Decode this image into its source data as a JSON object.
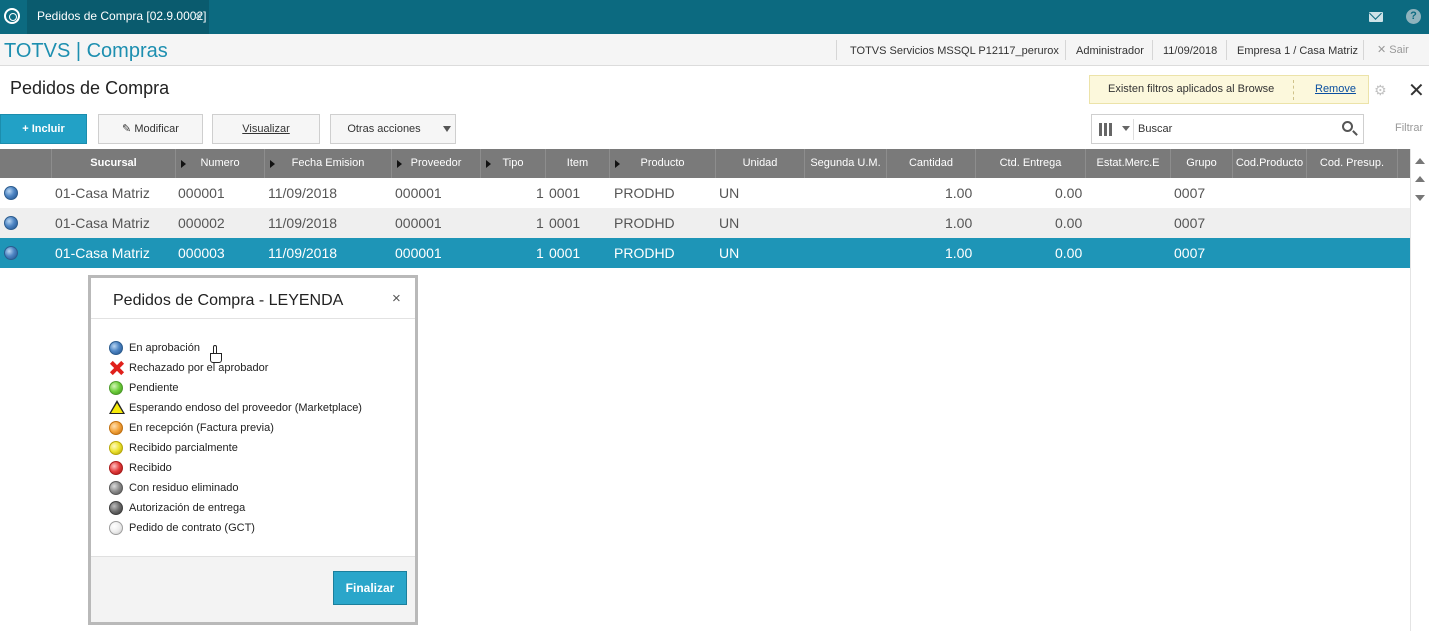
{
  "window": {
    "tab_title": "Pedidos de Compra [02.9.0002]",
    "tab_close": "×"
  },
  "header": {
    "brand": "TOTVS | Compras",
    "server": "TOTVS Servicios MSSQL P12117_perurox",
    "user": "Administrador",
    "date": "11/09/2018",
    "company": "Empresa 1 / Casa Matriz",
    "exit_label": "✕ Sair"
  },
  "page": {
    "title": "Pedidos de Compra",
    "close": "✕"
  },
  "notice": {
    "text": "Existen filtros aplicados al Browse",
    "remove_label": "Remove"
  },
  "toolbar": {
    "include_label": "+ Incluir",
    "modify_label": "✎ Modificar",
    "view_label": "Visualizar",
    "other_label": "Otras acciones"
  },
  "search": {
    "placeholder": "Buscar",
    "filter_label": "Filtrar"
  },
  "grid": {
    "columns": [
      "",
      "Sucursal",
      "Numero",
      "Fecha Emision",
      "Proveedor",
      "Tipo",
      "Item",
      "Producto",
      "Unidad",
      "Segunda U.M.",
      "Cantidad",
      "Ctd. Entrega",
      "Estat.Merc.E",
      "Grupo",
      "Cod.Producto",
      "Cod. Presup."
    ],
    "rows": [
      {
        "sucursal": "01-Casa Matriz",
        "numero": "000001",
        "fecha": "11/09/2018",
        "proveedor": "000001",
        "tipo": "1",
        "item": "0001",
        "producto": "PRODHD",
        "unidad": "UN",
        "cantidad": "1.00",
        "entrega": "0.00",
        "grupo": "0007"
      },
      {
        "sucursal": "01-Casa Matriz",
        "numero": "000002",
        "fecha": "11/09/2018",
        "proveedor": "000001",
        "tipo": "1",
        "item": "0001",
        "producto": "PRODHD",
        "unidad": "UN",
        "cantidad": "1.00",
        "entrega": "0.00",
        "grupo": "0007"
      },
      {
        "sucursal": "01-Casa Matriz",
        "numero": "000003",
        "fecha": "11/09/2018",
        "proveedor": "000001",
        "tipo": "1",
        "item": "0001",
        "producto": "PRODHD",
        "unidad": "UN",
        "cantidad": "1.00",
        "entrega": "0.00",
        "grupo": "0007"
      }
    ]
  },
  "legend_dialog": {
    "title": "Pedidos de Compra - LEYENDA",
    "close": "×",
    "items": [
      {
        "label": "En aprobación",
        "icon": "blue-ball-icon"
      },
      {
        "label": "Rechazado por el aprobador",
        "icon": "red-x-icon"
      },
      {
        "label": "Pendiente",
        "icon": "green-ball-icon"
      },
      {
        "label": "Esperando endoso del proveedor (Marketplace)",
        "icon": "warning-icon"
      },
      {
        "label": "En recepción (Factura previa)",
        "icon": "orange-ball-icon"
      },
      {
        "label": "Recibido parcialmente",
        "icon": "yellow-ball-icon"
      },
      {
        "label": "Recibido",
        "icon": "red-ball-icon"
      },
      {
        "label": "Con residuo eliminado",
        "icon": "grey-ball-icon"
      },
      {
        "label": "Autorización de entrega",
        "icon": "dark-grey-ball-icon"
      },
      {
        "label": "Pedido de contrato (GCT)",
        "icon": "white-ball-icon"
      }
    ],
    "finish_label": "Finalizar"
  },
  "colors": {
    "topbar": "#0c6a80",
    "brand": "#1d8fb0",
    "selected_row": "#1e95b7",
    "primary_button": "#22a1c6"
  }
}
